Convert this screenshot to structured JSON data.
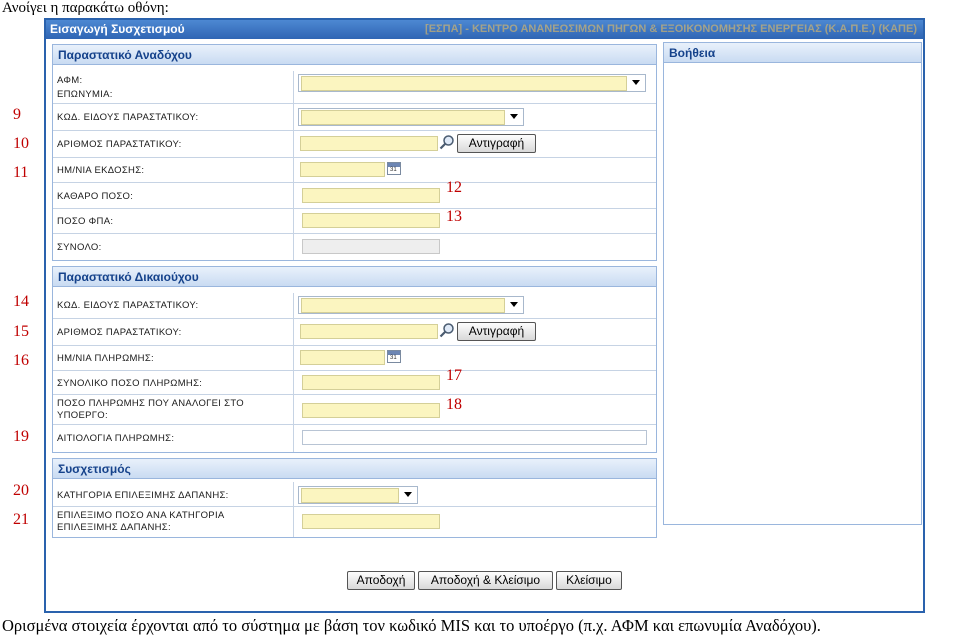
{
  "document": {
    "intro": "Ανοίγει η παρακάτω οθόνη:",
    "caption": "Ορισμένα στοιχεία έρχονται από το σύστημα με βάση τον κωδικό MIS και το υποέργο (π.χ. ΑΦΜ και επωνυμία Αναδόχου).",
    "callouts": [
      "9",
      "10",
      "11",
      "12",
      "13",
      "14",
      "15",
      "16",
      "17",
      "18",
      "19",
      "20",
      "21"
    ]
  },
  "window": {
    "title": "Εισαγωγή Συσχετισμού",
    "title_right": "[ΕΣΠΑ] - ΚΕΝΤΡΟ ΑΝΑΝΕΩΣΙΜΩΝ ΠΗΓΩΝ & ΕΞΟΙΚΟΝΟΜΗΣΗΣ ΕΝΕΡΓΕΙΑΣ (Κ.Α.Π.Ε.) (ΚΑΠΕ)"
  },
  "contractor": {
    "title": "Παραστατικό Αναδόχου",
    "afm_label": "ΑΦΜ:",
    "name_label": "ΕΠΩΝΥΜΙΑ:",
    "doc_type_label": "ΚΩΔ. ΕΙΔΟΥΣ ΠΑΡΑΣΤΑΤΙΚΟΥ:",
    "doc_number_label": "ΑΡΙΘΜΟΣ ΠΑΡΑΣΤΑΤΙΚΟΥ:",
    "copy_button": "Αντιγραφή",
    "issue_date_label": "ΗΜ/ΝΙΑ ΕΚΔΟΣΗΣ:",
    "net_label": "ΚΑΘΑΡΟ ΠΟΣΟ:",
    "vat_label": "ΠΟΣΟ ΦΠΑ:",
    "total_label": "ΣΥΝΟΛΟ:"
  },
  "beneficiary": {
    "title": "Παραστατικό Δικαιούχου",
    "doc_type_label": "ΚΩΔ. ΕΙΔΟΥΣ ΠΑΡΑΣΤΑΤΙΚΟΥ:",
    "doc_number_label": "ΑΡΙΘΜΟΣ ΠΑΡΑΣΤΑΤΙΚΟΥ:",
    "copy_button": "Αντιγραφή",
    "payment_date_label": "ΗΜ/ΝΙΑ ΠΛΗΡΩΜΗΣ:",
    "total_payment_label": "ΣΥΝΟΛΙΚΟ ΠΟΣΟ ΠΛΗΡΩΜΗΣ:",
    "subproject_payment_label_1": "ΠΟΣΟ ΠΛΗΡΩΜΗΣ ΠΟΥ ΑΝΑΛΟΓΕΙ ΣΤΟ",
    "subproject_payment_label_2": "ΥΠΟΕΡΓΟ:",
    "justification_label": "ΑΙΤΙΟΛΟΓΙΑ ΠΛΗΡΩΜΗΣ:"
  },
  "correlation": {
    "title": "Συσχετισμός",
    "category_label": "ΚΑΤΗΓΟΡΙΑ ΕΠΙΛΕΞΙΜΗΣ ΔΑΠΑΝΗΣ:",
    "eligible_label_1": "ΕΠΙΛΕΞΙΜΟ ΠΟΣΟ ΑΝΑ ΚΑΤΗΓΟΡΙΑ",
    "eligible_label_2": "ΕΠΙΛΕΞΙΜΗΣ ΔΑΠΑΝΗΣ:"
  },
  "help": {
    "title": "Βοήθεια"
  },
  "buttons": {
    "accept": "Αποδοχή",
    "accept_close": "Αποδοχή & Κλείσιμο",
    "close": "Κλείσιμο"
  },
  "colors": {
    "accent": "#2f65b4",
    "field_bg": "#fbf5c0",
    "callout": "#c00000",
    "panel_title": "#15428b"
  }
}
